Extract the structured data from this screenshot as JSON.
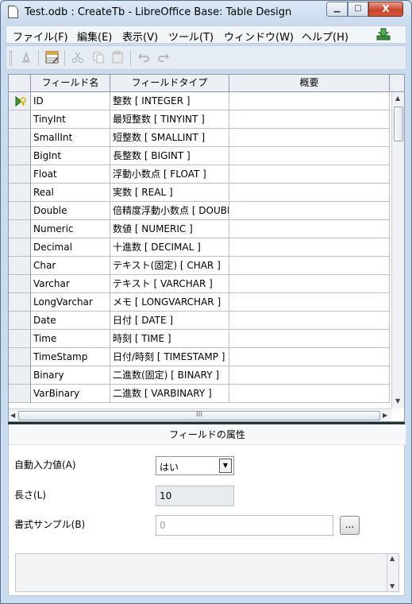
{
  "window": {
    "title": "Test.odb : CreateTb - LibreOffice Base: Table Design",
    "buttons": {
      "minimize": "▁",
      "maximize": "□",
      "close": "X"
    }
  },
  "menu": [
    "ファイル(F)",
    "編集(E)",
    "表示(V)",
    "ツール(T)",
    "ウィンドウ(W)",
    "ヘルプ(H)"
  ],
  "toolbar": {
    "icons": [
      "edit-icon",
      "index-design-icon",
      "cut-icon",
      "copy-icon",
      "paste-icon",
      "undo-icon",
      "redo-icon"
    ]
  },
  "grid": {
    "columns": [
      "フィールド名",
      "フィールドタイプ",
      "概要"
    ],
    "rows": [
      {
        "name": "ID",
        "type": "整数 [ INTEGER ]",
        "primary_key": true
      },
      {
        "name": "TinyInt",
        "type": "最短整数 [ TINYINT ]"
      },
      {
        "name": "SmallInt",
        "type": "短整数 [ SMALLINT ]"
      },
      {
        "name": "BigInt",
        "type": "長整数 [ BIGINT ]"
      },
      {
        "name": "Float",
        "type": "浮動小数点 [ FLOAT ]"
      },
      {
        "name": "Real",
        "type": "実数 [ REAL ]"
      },
      {
        "name": "Double",
        "type": "倍精度浮動小数点 [ DOUBLE ]"
      },
      {
        "name": "Numeric",
        "type": "数値 [ NUMERIC ]"
      },
      {
        "name": "Decimal",
        "type": "十進数 [ DECIMAL ]"
      },
      {
        "name": "Char",
        "type": "テキスト(固定) [ CHAR ]"
      },
      {
        "name": "Varchar",
        "type": "テキスト [ VARCHAR ]"
      },
      {
        "name": "LongVarchar",
        "type": "メモ [ LONGVARCHAR ]"
      },
      {
        "name": "Date",
        "type": "日付 [ DATE ]"
      },
      {
        "name": "Time",
        "type": "時刻 [ TIME ]"
      },
      {
        "name": "TimeStamp",
        "type": "日付/時刻 [ TIMESTAMP ]"
      },
      {
        "name": "Binary",
        "type": "二進数(固定) [ BINARY ]"
      },
      {
        "name": "VarBinary",
        "type": "二進数 [ VARBINARY ]"
      }
    ],
    "hscroll_grip": "III"
  },
  "properties": {
    "title": "フィールドの属性",
    "auto_value_label": "自動入力値(A)",
    "auto_value": "はい",
    "length_label": "長さ(L)",
    "length": "10",
    "format_label": "書式サンプル(B)",
    "format_value": "0",
    "format_button": "..."
  },
  "colors": {
    "accent": "#5a6f8a",
    "close": "#c9452d",
    "key": "#d4b000"
  }
}
